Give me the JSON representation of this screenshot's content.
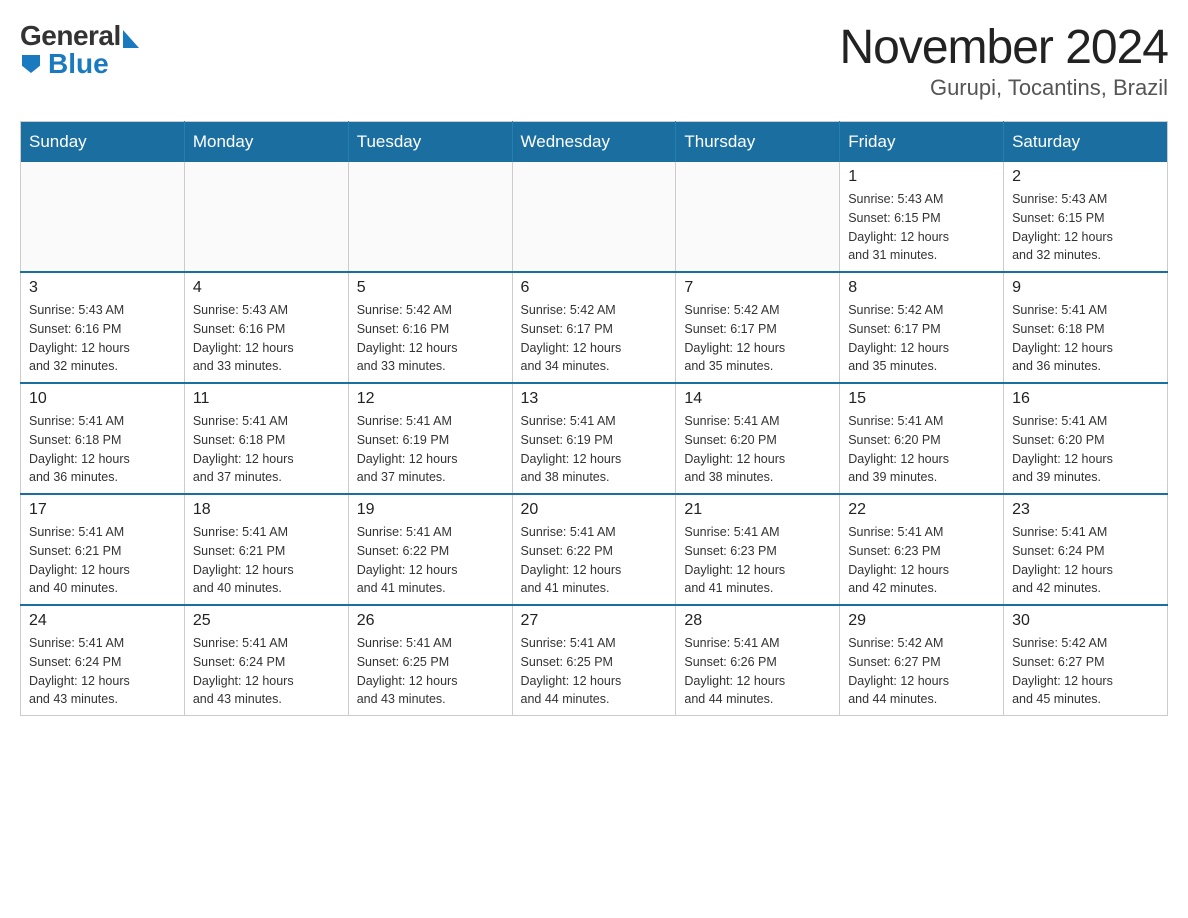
{
  "logo": {
    "general": "General",
    "blue": "Blue",
    "subtitle": ""
  },
  "title": "November 2024",
  "subtitle": "Gurupi, Tocantins, Brazil",
  "weekdays": [
    "Sunday",
    "Monday",
    "Tuesday",
    "Wednesday",
    "Thursday",
    "Friday",
    "Saturday"
  ],
  "weeks": [
    [
      {
        "day": "",
        "info": ""
      },
      {
        "day": "",
        "info": ""
      },
      {
        "day": "",
        "info": ""
      },
      {
        "day": "",
        "info": ""
      },
      {
        "day": "",
        "info": ""
      },
      {
        "day": "1",
        "info": "Sunrise: 5:43 AM\nSunset: 6:15 PM\nDaylight: 12 hours\nand 31 minutes."
      },
      {
        "day": "2",
        "info": "Sunrise: 5:43 AM\nSunset: 6:15 PM\nDaylight: 12 hours\nand 32 minutes."
      }
    ],
    [
      {
        "day": "3",
        "info": "Sunrise: 5:43 AM\nSunset: 6:16 PM\nDaylight: 12 hours\nand 32 minutes."
      },
      {
        "day": "4",
        "info": "Sunrise: 5:43 AM\nSunset: 6:16 PM\nDaylight: 12 hours\nand 33 minutes."
      },
      {
        "day": "5",
        "info": "Sunrise: 5:42 AM\nSunset: 6:16 PM\nDaylight: 12 hours\nand 33 minutes."
      },
      {
        "day": "6",
        "info": "Sunrise: 5:42 AM\nSunset: 6:17 PM\nDaylight: 12 hours\nand 34 minutes."
      },
      {
        "day": "7",
        "info": "Sunrise: 5:42 AM\nSunset: 6:17 PM\nDaylight: 12 hours\nand 35 minutes."
      },
      {
        "day": "8",
        "info": "Sunrise: 5:42 AM\nSunset: 6:17 PM\nDaylight: 12 hours\nand 35 minutes."
      },
      {
        "day": "9",
        "info": "Sunrise: 5:41 AM\nSunset: 6:18 PM\nDaylight: 12 hours\nand 36 minutes."
      }
    ],
    [
      {
        "day": "10",
        "info": "Sunrise: 5:41 AM\nSunset: 6:18 PM\nDaylight: 12 hours\nand 36 minutes."
      },
      {
        "day": "11",
        "info": "Sunrise: 5:41 AM\nSunset: 6:18 PM\nDaylight: 12 hours\nand 37 minutes."
      },
      {
        "day": "12",
        "info": "Sunrise: 5:41 AM\nSunset: 6:19 PM\nDaylight: 12 hours\nand 37 minutes."
      },
      {
        "day": "13",
        "info": "Sunrise: 5:41 AM\nSunset: 6:19 PM\nDaylight: 12 hours\nand 38 minutes."
      },
      {
        "day": "14",
        "info": "Sunrise: 5:41 AM\nSunset: 6:20 PM\nDaylight: 12 hours\nand 38 minutes."
      },
      {
        "day": "15",
        "info": "Sunrise: 5:41 AM\nSunset: 6:20 PM\nDaylight: 12 hours\nand 39 minutes."
      },
      {
        "day": "16",
        "info": "Sunrise: 5:41 AM\nSunset: 6:20 PM\nDaylight: 12 hours\nand 39 minutes."
      }
    ],
    [
      {
        "day": "17",
        "info": "Sunrise: 5:41 AM\nSunset: 6:21 PM\nDaylight: 12 hours\nand 40 minutes."
      },
      {
        "day": "18",
        "info": "Sunrise: 5:41 AM\nSunset: 6:21 PM\nDaylight: 12 hours\nand 40 minutes."
      },
      {
        "day": "19",
        "info": "Sunrise: 5:41 AM\nSunset: 6:22 PM\nDaylight: 12 hours\nand 41 minutes."
      },
      {
        "day": "20",
        "info": "Sunrise: 5:41 AM\nSunset: 6:22 PM\nDaylight: 12 hours\nand 41 minutes."
      },
      {
        "day": "21",
        "info": "Sunrise: 5:41 AM\nSunset: 6:23 PM\nDaylight: 12 hours\nand 41 minutes."
      },
      {
        "day": "22",
        "info": "Sunrise: 5:41 AM\nSunset: 6:23 PM\nDaylight: 12 hours\nand 42 minutes."
      },
      {
        "day": "23",
        "info": "Sunrise: 5:41 AM\nSunset: 6:24 PM\nDaylight: 12 hours\nand 42 minutes."
      }
    ],
    [
      {
        "day": "24",
        "info": "Sunrise: 5:41 AM\nSunset: 6:24 PM\nDaylight: 12 hours\nand 43 minutes."
      },
      {
        "day": "25",
        "info": "Sunrise: 5:41 AM\nSunset: 6:24 PM\nDaylight: 12 hours\nand 43 minutes."
      },
      {
        "day": "26",
        "info": "Sunrise: 5:41 AM\nSunset: 6:25 PM\nDaylight: 12 hours\nand 43 minutes."
      },
      {
        "day": "27",
        "info": "Sunrise: 5:41 AM\nSunset: 6:25 PM\nDaylight: 12 hours\nand 44 minutes."
      },
      {
        "day": "28",
        "info": "Sunrise: 5:41 AM\nSunset: 6:26 PM\nDaylight: 12 hours\nand 44 minutes."
      },
      {
        "day": "29",
        "info": "Sunrise: 5:42 AM\nSunset: 6:27 PM\nDaylight: 12 hours\nand 44 minutes."
      },
      {
        "day": "30",
        "info": "Sunrise: 5:42 AM\nSunset: 6:27 PM\nDaylight: 12 hours\nand 45 minutes."
      }
    ]
  ]
}
